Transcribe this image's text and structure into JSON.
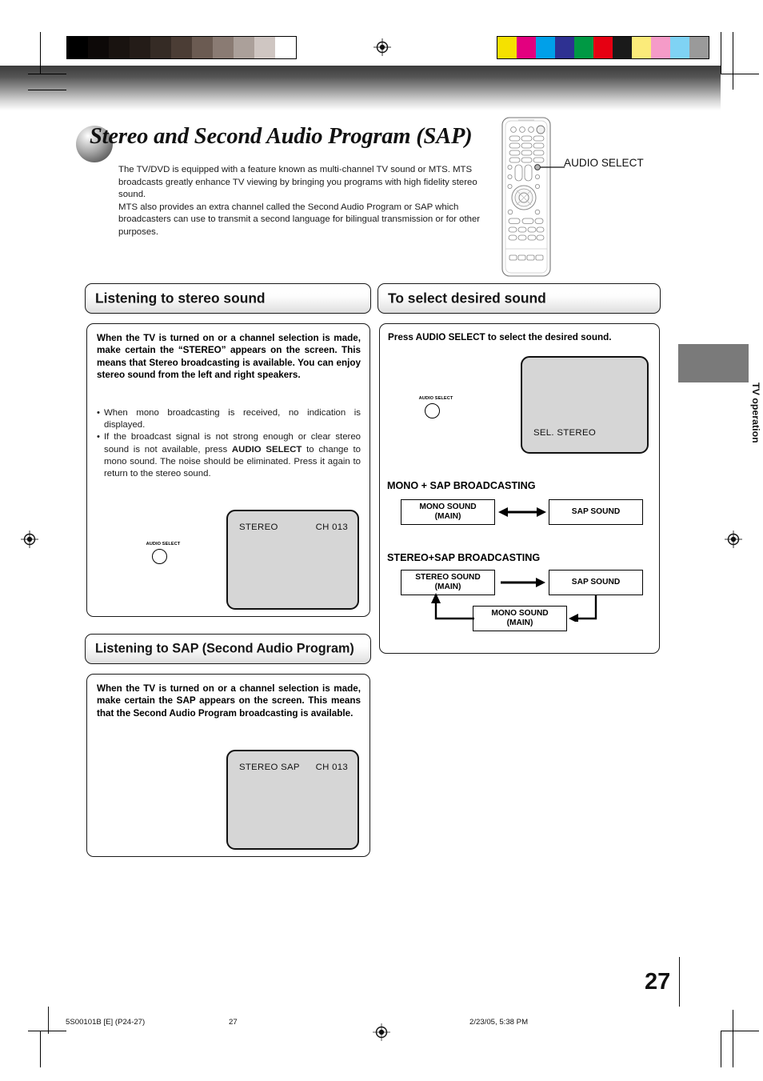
{
  "document": {
    "page_number": "27",
    "side_tab": "TV operation",
    "footer": {
      "doc_code": "5S00101B [E] (P24-27)",
      "page": "27",
      "timestamp": "2/23/05, 5:38 PM"
    }
  },
  "header": {
    "title": "Stereo and Second Audio Program (SAP)",
    "intro_paragraphs": [
      "The TV/DVD is equipped with a feature known as multi-channel TV sound or MTS. MTS broadcasts greatly enhance TV viewing by bringing you programs with high fidelity stereo sound.",
      "MTS also provides an extra channel called the Second Audio Program or SAP which broadcasters can use to transmit a second language for bilingual transmission or for other purposes."
    ],
    "remote_callout": "AUDIO SELECT"
  },
  "left_column": {
    "stereo_section": {
      "heading": "Listening to stereo sound",
      "bold_text": "When the TV is turned on or a channel selection is made, make certain the “STEREO” appears on the screen. This means that Stereo broadcasting is available. You can enjoy stereo sound from the left and right speakers.",
      "bullets": [
        "When mono broadcasting is received, no indication is displayed.",
        "If the broadcast signal is not strong enough or clear stereo sound is not available, press AUDIO SELECT to change to mono sound. The noise should be eliminated. Press it again to return to the stereo sound."
      ],
      "bullet2_parts": {
        "before": "If the broadcast signal is not strong enough or clear stereo sound is not available, press ",
        "bold": "AUDIO SELECT",
        "after": " to change to mono sound. The noise should be eliminated. Press it again to return to the stereo sound."
      },
      "button_label": "AUDIO SELECT",
      "tv_screen": {
        "left_text": "STEREO",
        "right_text": "CH 013"
      }
    },
    "sap_section": {
      "heading": "Listening to SAP (Second Audio Program)",
      "bold_text": "When the TV is turned on or a channel selection is made, make certain the SAP appears on the screen. This means that the Second Audio Program broadcasting is available.",
      "tv_screen": {
        "left_text": "STEREO  SAP",
        "right_text": "CH 013"
      }
    }
  },
  "right_column": {
    "heading": "To select desired sound",
    "instruction": "Press AUDIO SELECT to select the desired sound.",
    "button_label": "AUDIO SELECT",
    "tv_screen": {
      "osd_text": "SEL. STEREO"
    },
    "diagrams": [
      {
        "title": "MONO + SAP BROADCASTING",
        "boxes": [
          {
            "line1": "MONO SOUND",
            "line2": "(MAIN)"
          },
          {
            "line1": "SAP SOUND",
            "line2": ""
          }
        ],
        "arrow": "bidirectional"
      },
      {
        "title": "STEREO+SAP BROADCASTING",
        "boxes": [
          {
            "line1": "STEREO SOUND",
            "line2": "(MAIN)"
          },
          {
            "line1": "SAP SOUND",
            "line2": ""
          },
          {
            "line1": "MONO SOUND",
            "line2": "(MAIN)"
          }
        ],
        "arrow": "cycle"
      }
    ]
  },
  "print_marks": {
    "grayscale_swatches": [
      "#000000",
      "#0d0908",
      "#191310",
      "#241c18",
      "#352b25",
      "#4b3d35",
      "#6b5b52",
      "#8a7b73",
      "#aba09a",
      "#cfc6c2",
      "#ffffff"
    ],
    "color_swatches": [
      "#f5e100",
      "#e3007f",
      "#00a0e9",
      "#2e3192",
      "#009944",
      "#e60012",
      "#1a1a1a",
      "#fbeb7a",
      "#f59bc8",
      "#7fd3f4",
      "#9a9a9a"
    ]
  }
}
